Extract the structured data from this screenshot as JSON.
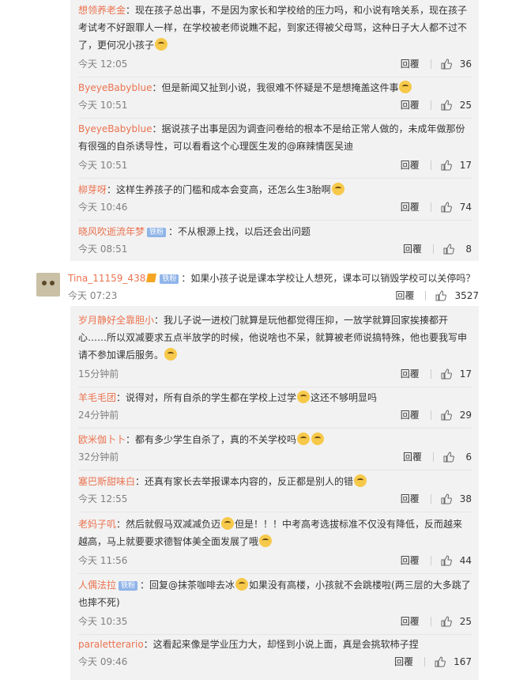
{
  "replies_top": [
    {
      "user": "想领养老金",
      "badge": "",
      "text": "：现在孩子总出事，不是因为家长和学校给的压力吗，和小说有啥关系，现在孩子考试考不好跟罪人一样，在学校被老师说瞧不起，到家还得被父母骂，这种日子大人都不过不了，更何况小孩子",
      "emoji": [
        "cry"
      ],
      "time": "今天 12:05",
      "likes": "36"
    },
    {
      "user": "ByeyeBabyblue",
      "badge": "",
      "text": "：但是新闻又扯到小说，我很难不怀疑是不是想掩盖这件事",
      "emoji": [
        "sigh"
      ],
      "time": "今天 10:51",
      "likes": "25"
    },
    {
      "user": "ByeyeBabyblue",
      "badge": "",
      "text": "：据说孩子出事是因为调查问卷给的根本不是给正常人做的，未成年做那份有很强的自杀诱导性，可以看看这个心理医生发的@麻辣情医吴迪",
      "emoji": [],
      "time": "今天 10:51",
      "likes": "17"
    },
    {
      "user": "柳芽呀",
      "badge": "",
      "text": "：这样生养孩子的门槛和成本会变高，还怎么生3胎啊",
      "emoji": [
        "think"
      ],
      "time": "今天 10:46",
      "likes": "74"
    },
    {
      "user": "晓风吹逝流年梦",
      "badge": "铁粉",
      "text": "：不从根源上找，以后还会出问题",
      "emoji": [],
      "time": "今天 08:51",
      "likes": "8"
    }
  ],
  "top_comment": {
    "user": "Tina_11159_438",
    "badge": "铁粉",
    "text": "：如果小孩子说是课本学校让人想死，课本可以销毁学校可以关停吗？",
    "time": "今天 07:23",
    "likes": "3527"
  },
  "replies_bottom": [
    {
      "user": "岁月静好全靠胆小",
      "badge": "",
      "text": "：我儿子说一进校门就算是玩他都觉得压抑，一放学就算回家挨揍都开心……所以双减要求五点半放学的时候，他说啥也不呆，就算被老师说搞特殊，他也要我写申请不参加课后服务。",
      "emoji": [
        "cry"
      ],
      "time": "15分钟前",
      "likes": "17"
    },
    {
      "user": "羊毛毛团",
      "badge": "",
      "text": "：说得对，所有自杀的学生都在学校上过学",
      "emoji": [
        "doge"
      ],
      "after": "这还不够明显吗",
      "time": "24分钟前",
      "likes": "29"
    },
    {
      "user": "欧米伽卜卜",
      "badge": "",
      "text": "：都有多少学生自杀了，真的不关学校吗",
      "emoji": [
        "cry",
        "cry"
      ],
      "time": "32分钟前",
      "likes": "6"
    },
    {
      "user": "塞巴斯甜味白",
      "badge": "",
      "text": "：还真有家长去举报课本内容的，反正都是别人的错",
      "emoji": [
        "smirk"
      ],
      "time": "今天 12:55",
      "likes": "38"
    },
    {
      "user": "老妈子叽",
      "badge": "",
      "text": "：然后就假马双减减负迈",
      "emoji": [
        "doge"
      ],
      "after": "但是！！！中考高考选拔标准不仅没有降低，反而越来越高，马上就要要求德智体美全面发展了哦",
      "emoji2": [
        "doge"
      ],
      "time": "今天 11:56",
      "likes": "44"
    },
    {
      "user": "人偶法拉",
      "badge": "铁粉",
      "text": "：回复@抹茶咖啡去冰",
      "emoji": [
        "dog"
      ],
      "after": "如果没有高楼，小孩就不会跳楼啦(两三层的大多跳了也摔不死)",
      "time": "今天 10:35",
      "likes": "25"
    },
    {
      "user": "paraletterario",
      "badge": "",
      "text": "：这看起来像是学业压力大，却怪到小说上面，真是会挑软柿子捏",
      "emoji": [],
      "time": "今天 09:46",
      "likes": "167"
    }
  ],
  "labels": {
    "reply": "回覆"
  }
}
